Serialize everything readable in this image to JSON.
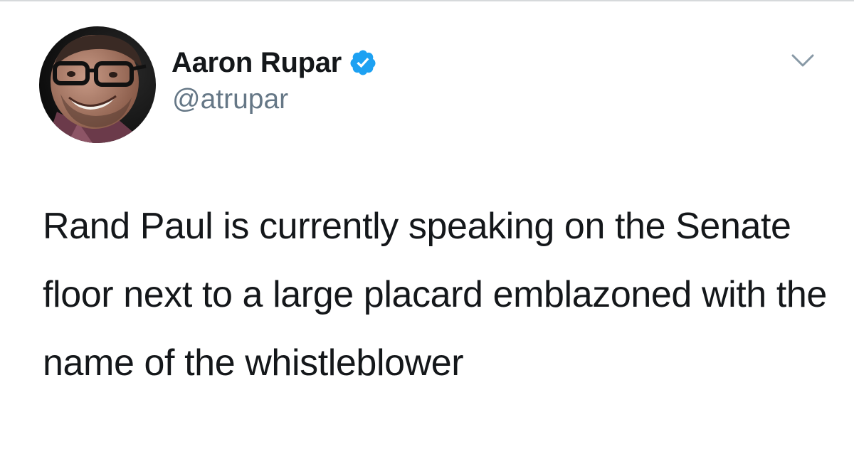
{
  "author": {
    "display_name": "Aaron Rupar",
    "handle": "@atrupar",
    "verified": true,
    "avatar_icon": "avatar-photo"
  },
  "menu": {
    "icon": "chevron-down-icon"
  },
  "tweet": {
    "text": "Rand Paul is currently speaking on the Senate floor next to a large placard emblazoned with the name of the whistleblower"
  },
  "colors": {
    "text": "#14171a",
    "secondary": "#657786",
    "verified_badge": "#1da1f2",
    "divider": "#d6d9db"
  }
}
